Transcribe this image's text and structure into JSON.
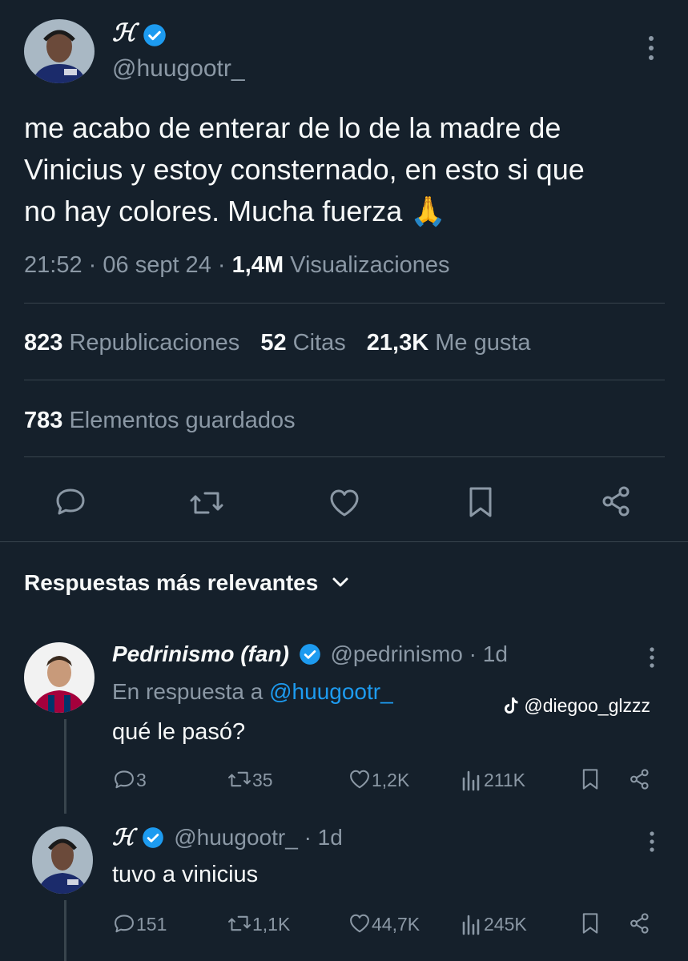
{
  "main_tweet": {
    "author_name": "ℋ",
    "author_handle": "@huugootr_",
    "text_lines": [
      "me acabo de enterar de lo de la madre de",
      "Vinicius y estoy consternado, en esto si que",
      "no hay colores. Mucha fuerza 🙏"
    ],
    "time": "21:52",
    "sep": "·",
    "date": "06 sept 24",
    "views_count": "1,4M",
    "views_label": "Visualizaciones",
    "reposts_count": "823",
    "reposts_label": "Republicaciones",
    "quotes_count": "52",
    "quotes_label": "Citas",
    "likes_count": "21,3K",
    "likes_label": "Me gusta",
    "bookmarks_count": "783",
    "bookmarks_label": "Elementos guardados"
  },
  "replies_header": {
    "label": "Respuestas más relevantes"
  },
  "reply1": {
    "author_name": "Pedrinismo (fan)",
    "author_handle": "@pedrinismo",
    "age": "· 1d",
    "in_reply_prefix": "En respuesta a",
    "in_reply_handle": "@huugootr_",
    "text": "qué le pasó?",
    "replies": "3",
    "reposts": "35",
    "likes": "1,2K",
    "views": "211K"
  },
  "reply2": {
    "author_name": "ℋ",
    "author_handle": "@huugootr_",
    "age": "· 1d",
    "text": "tuvo a vinicius",
    "replies": "151",
    "reposts": "1,1K",
    "likes": "44,7K",
    "views": "245K"
  },
  "watermark": {
    "text": "@diegoo_glzzz"
  },
  "colors": {
    "background": "#15202b",
    "text": "#f7f9f9",
    "muted": "#8b98a5",
    "link": "#1d9bf0",
    "verified": "#1d9bf0",
    "divider": "#38444d"
  }
}
